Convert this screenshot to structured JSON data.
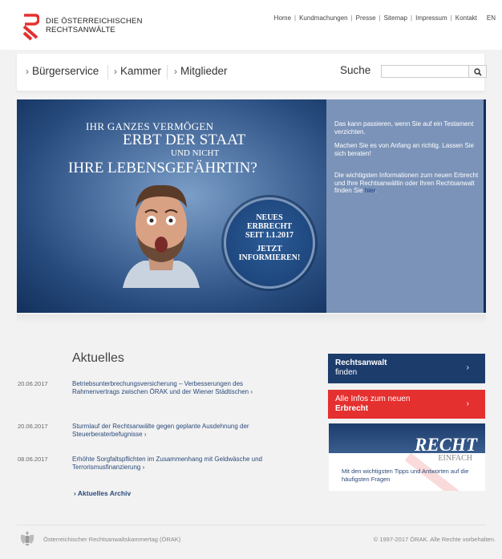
{
  "header": {
    "logo_line1": "DIE ÖSTERREICHISCHEN",
    "logo_line2": "RECHTSANWÄLTE",
    "topnav": [
      "Home",
      "Kundmachungen",
      "Presse",
      "Sitemap",
      "Impressum",
      "Kontakt"
    ],
    "language": "EN"
  },
  "nav": {
    "items": [
      "Bürgerservice",
      "Kammer",
      "Mitglieder"
    ],
    "search_label": "Suche",
    "search_placeholder": ""
  },
  "hero": {
    "line1": "IHR GANZES VERMÖGEN",
    "line2": "ERBT DER STAAT",
    "line3": "UND NICHT",
    "line4": "IHRE LEBENSGEFÄHRTIN?",
    "circle": [
      "NEUES",
      "ERBRECHT",
      "SEIT 1.1.2017",
      "JETZT",
      "INFORMIEREN!"
    ],
    "right_p1": "Das kann passieren, wenn Sie auf ein Testament verzichten.",
    "right_p2": "Machen Sie es von Anfang an richtig. Lassen Sie sich beraten!",
    "right_p3": "Die wichtigsten Informationen zum neuen Erbrecht und Ihre Rechtsanwältin oder Ihren Rechtsanwalt finden Sie",
    "right_link": "hier",
    "right_end": "."
  },
  "news": {
    "heading": "Aktuelles",
    "items": [
      {
        "date": "20.06.2017",
        "text": "Betriebsunterbrechungsversicherung – Verbesserungen des Rahmenvertrags zwischen ÖRAK und der Wiener Städtischen"
      },
      {
        "date": "20.06.2017",
        "text": "Sturmlauf der Rechtsanwälte gegen geplante Ausdehnung der Steuerberaterbefugnisse"
      },
      {
        "date": "08.06.2017",
        "text": "Erhöhte Sorgfaltspflichten im Zusammenhang mit Geldwäsche und Terrorismusfinanzierung"
      }
    ],
    "archive": "Aktuelles Archiv"
  },
  "boxes": {
    "box1_line1": "Rechtsanwalt",
    "box1_line2": "finden",
    "box2_line1": "Alle Infos zum neuen",
    "box2_line2": "Erbrecht",
    "box3_title": "RECHT",
    "box3_sub": "EINFACH",
    "box3_text": "Mit den wichtigsten Tipps und Antworten auf die häufigsten Fragen"
  },
  "footer": {
    "left": "Österreichischer Rechtsanwaltskammertag (ÖRAK)",
    "right": "© 1997-2017 ÖRAK. Alle Rechte vorbehalten."
  },
  "colors": {
    "brand_red": "#e53030",
    "brand_blue": "#1c3c6c",
    "link_blue": "#2a4a7a"
  }
}
